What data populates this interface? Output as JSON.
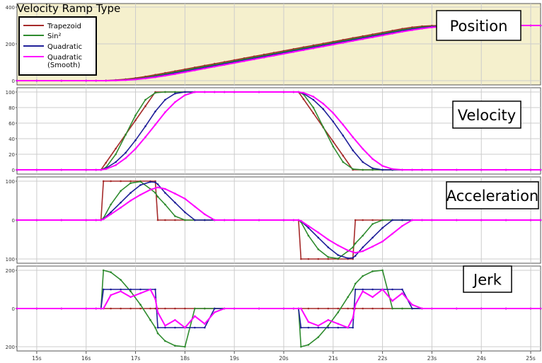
{
  "legend": {
    "title": "Velocity Ramp Type",
    "placement": "top-left",
    "items": [
      {
        "label": "Trapezoid",
        "color": "#a52a2a"
      },
      {
        "label": "Sin²",
        "color": "#2e8b2e"
      },
      {
        "label": "Quadratic",
        "color": "#1f1f99"
      },
      {
        "label": "Quadratic\n(Smooth)",
        "color": "#ff00ff"
      }
    ]
  },
  "colors": {
    "position_background": "#f5f0cd",
    "grid": "#cccccc",
    "axis": "#555555"
  },
  "x_axis": {
    "ticks": [
      15,
      16,
      17,
      18,
      19,
      20,
      21,
      22,
      23,
      24,
      25
    ],
    "tick_labels": [
      "15s",
      "16s",
      "17s",
      "18s",
      "19s",
      "20s",
      "21s",
      "22s",
      "23s",
      "24s",
      "25s"
    ],
    "range": [
      14.6,
      25.2
    ]
  },
  "chart_data": [
    {
      "type": "line",
      "title": "Position",
      "ylim": [
        0,
        400
      ],
      "yticks": [
        0,
        200,
        400
      ],
      "ytick_labels": [
        "0",
        "200",
        "400"
      ],
      "grid": true,
      "x": [
        14.6,
        15,
        15.5,
        16,
        16.2,
        16.4,
        16.6,
        16.8,
        17,
        17.2,
        17.4,
        17.6,
        17.8,
        18,
        18.2,
        18.4,
        18.6,
        18.8,
        19,
        19.2,
        19.4,
        19.6,
        19.8,
        20,
        20.2,
        20.4,
        20.6,
        20.8,
        21,
        21.2,
        21.4,
        21.6,
        21.8,
        22,
        22.2,
        22.4,
        22.6,
        22.8,
        23,
        23.5,
        24,
        24.5,
        25,
        25.2
      ],
      "series": [
        {
          "name": "Trapezoid",
          "values": [
            0,
            0,
            0,
            0,
            0,
            0.9,
            3.6,
            8.1,
            14.4,
            22.5,
            32,
            42,
            52,
            62,
            72,
            82,
            92,
            102,
            112,
            122,
            132,
            142,
            152,
            162,
            172,
            182,
            192,
            202,
            212,
            222,
            232,
            242,
            252,
            262,
            272,
            282,
            290,
            296,
            299,
            300,
            300,
            300,
            300,
            300
          ]
        },
        {
          "name": "Sin²",
          "values": [
            0,
            0,
            0,
            0,
            0,
            0.3,
            2,
            5,
            10,
            17,
            26,
            36,
            46,
            56,
            66,
            76,
            86,
            96,
            106,
            116,
            126,
            136,
            146,
            156,
            166,
            176,
            186,
            196,
            206,
            216,
            226,
            236,
            246,
            256,
            266,
            276,
            284,
            291,
            295,
            300,
            300,
            300,
            300,
            300
          ]
        },
        {
          "name": "Quadratic",
          "values": [
            0,
            0,
            0,
            0,
            0,
            0.2,
            1.5,
            4,
            8,
            14,
            22,
            31,
            41,
            51,
            61,
            71,
            81,
            91,
            101,
            111,
            121,
            131,
            141,
            151,
            161,
            171,
            181,
            191,
            201,
            211,
            221,
            231,
            241,
            251,
            261,
            271,
            280,
            287,
            293,
            300,
            300,
            300,
            300,
            300
          ]
        },
        {
          "name": "Quadratic\n(Smooth)",
          "values": [
            0,
            0,
            0,
            0,
            0,
            0.1,
            1,
            3,
            6.5,
            12,
            19,
            27,
            36,
            46,
            56,
            66,
            76,
            86,
            96,
            106,
            116,
            126,
            136,
            146,
            156,
            166,
            176,
            186,
            196,
            206,
            216,
            226,
            236,
            246,
            256,
            266,
            275,
            283,
            290,
            299,
            300,
            300,
            300,
            300
          ]
        }
      ]
    },
    {
      "type": "line",
      "title": "Velocity",
      "ylim": [
        0,
        100
      ],
      "yticks": [
        0,
        20,
        40,
        60,
        80,
        100
      ],
      "ytick_labels": [
        "0",
        "20",
        "40",
        "60",
        "80",
        "100"
      ],
      "grid": true,
      "x": [
        14.6,
        15,
        15.5,
        16,
        16.2,
        16.3,
        16.4,
        16.6,
        16.8,
        17,
        17.2,
        17.4,
        17.6,
        17.8,
        18,
        18.2,
        18.4,
        18.6,
        18.8,
        19,
        19.5,
        20,
        20.2,
        20.3,
        20.4,
        20.6,
        20.8,
        21,
        21.2,
        21.4,
        21.6,
        21.8,
        22,
        22.2,
        22.4,
        22.6,
        22.8,
        23,
        23.5,
        24,
        24.5,
        25,
        25.2
      ],
      "series": [
        {
          "name": "Trapezoid",
          "values": [
            0,
            0,
            0,
            0,
            0,
            0,
            9.1,
            27.3,
            45.5,
            63.6,
            81.8,
            100,
            100,
            100,
            100,
            100,
            100,
            100,
            100,
            100,
            100,
            100,
            100,
            100,
            90.9,
            72.7,
            54.5,
            36.4,
            18.2,
            0,
            0,
            0,
            0,
            0,
            0,
            0,
            0,
            0,
            0,
            0,
            0,
            0,
            0
          ]
        },
        {
          "name": "Sin²",
          "values": [
            0,
            0,
            0,
            0,
            0,
            0,
            3,
            20,
            45,
            70,
            90,
            99,
            100,
            100,
            100,
            100,
            100,
            100,
            100,
            100,
            100,
            100,
            100,
            100,
            97,
            80,
            55,
            30,
            10,
            1,
            0,
            0,
            0,
            0,
            0,
            0,
            0,
            0,
            0,
            0,
            0,
            0,
            0
          ]
        },
        {
          "name": "Quadratic",
          "values": [
            0,
            0,
            0,
            0,
            0,
            0,
            2,
            10,
            22,
            38,
            56,
            75,
            90,
            98,
            100,
            100,
            100,
            100,
            100,
            100,
            100,
            100,
            100,
            100,
            98,
            90,
            78,
            62,
            44,
            25,
            10,
            2,
            0,
            0,
            0,
            0,
            0,
            0,
            0,
            0,
            0,
            0,
            0
          ]
        },
        {
          "name": "Quadratic\n(Smooth)",
          "values": [
            0,
            0,
            0,
            0,
            0,
            0,
            1,
            6,
            15,
            27,
            42,
            58,
            74,
            87,
            96,
            100,
            100,
            100,
            100,
            100,
            100,
            100,
            100,
            100,
            99,
            94,
            85,
            73,
            58,
            42,
            27,
            14,
            5,
            1,
            0,
            0,
            0,
            0,
            0,
            0,
            0,
            0,
            0
          ]
        }
      ]
    },
    {
      "type": "line",
      "title": "Acceleration",
      "ylim": [
        -100,
        100
      ],
      "yticks": [
        -100,
        0,
        100
      ],
      "ytick_labels": [
        "100",
        "0",
        "100"
      ],
      "grid": true,
      "x": [
        14.6,
        15,
        15.5,
        16,
        16.2,
        16.3,
        16.35,
        16.5,
        16.7,
        16.9,
        17.1,
        17.3,
        17.4,
        17.45,
        17.6,
        17.8,
        18,
        18.2,
        18.4,
        18.6,
        18.8,
        19,
        19.5,
        20,
        20.2,
        20.3,
        20.35,
        20.5,
        20.7,
        20.9,
        21.1,
        21.3,
        21.4,
        21.45,
        21.6,
        21.8,
        22,
        22.2,
        22.4,
        22.6,
        22.8,
        23,
        23.5,
        24,
        24.5,
        25,
        25.2
      ],
      "series": [
        {
          "name": "Trapezoid",
          "values": [
            0,
            0,
            0,
            0,
            0,
            0,
            100,
            100,
            100,
            100,
            100,
            100,
            100,
            0,
            0,
            0,
            0,
            0,
            0,
            0,
            0,
            0,
            0,
            0,
            0,
            0,
            -100,
            -100,
            -100,
            -100,
            -100,
            -100,
            -100,
            0,
            0,
            0,
            0,
            0,
            0,
            0,
            0,
            0,
            0,
            0,
            0,
            0,
            0
          ]
        },
        {
          "name": "Sin²",
          "values": [
            0,
            0,
            0,
            0,
            0,
            0,
            5,
            40,
            75,
            95,
            99,
            80,
            70,
            60,
            40,
            10,
            0,
            0,
            0,
            0,
            0,
            0,
            0,
            0,
            0,
            0,
            -5,
            -40,
            -75,
            -95,
            -99,
            -80,
            -70,
            -60,
            -40,
            -10,
            0,
            0,
            0,
            0,
            0,
            0,
            0,
            0,
            0,
            0,
            0
          ]
        },
        {
          "name": "Quadratic",
          "values": [
            0,
            0,
            0,
            0,
            0,
            0,
            3,
            20,
            45,
            70,
            90,
            98,
            97,
            92,
            70,
            45,
            20,
            0,
            0,
            0,
            0,
            0,
            0,
            0,
            0,
            0,
            -3,
            -20,
            -45,
            -70,
            -90,
            -98,
            -97,
            -92,
            -70,
            -45,
            -20,
            0,
            0,
            0,
            0,
            0,
            0,
            0,
            0,
            0,
            0
          ]
        },
        {
          "name": "Quadratic\n(Smooth)",
          "values": [
            0,
            0,
            0,
            0,
            0,
            0,
            2,
            15,
            32,
            50,
            65,
            78,
            82,
            84,
            80,
            68,
            55,
            35,
            15,
            0,
            0,
            0,
            0,
            0,
            0,
            0,
            -2,
            -15,
            -32,
            -50,
            -65,
            -78,
            -82,
            -84,
            -80,
            -68,
            -55,
            -35,
            -15,
            0,
            0,
            0,
            0,
            0,
            0,
            0,
            0
          ]
        }
      ]
    },
    {
      "type": "line",
      "title": "Jerk",
      "ylim": [
        -200,
        200
      ],
      "yticks": [
        -200,
        0,
        200
      ],
      "ytick_labels": [
        "200",
        "0",
        "200"
      ],
      "grid": true,
      "x": [
        14.6,
        15,
        15.5,
        16,
        16.2,
        16.3,
        16.35,
        16.5,
        16.7,
        16.9,
        17.1,
        17.3,
        17.4,
        17.45,
        17.6,
        17.8,
        18,
        18.2,
        18.4,
        18.6,
        18.8,
        19,
        19.5,
        20,
        20.2,
        20.3,
        20.35,
        20.5,
        20.7,
        20.9,
        21.1,
        21.3,
        21.4,
        21.45,
        21.6,
        21.8,
        22,
        22.2,
        22.4,
        22.6,
        22.8,
        23,
        23.5,
        24,
        24.5,
        25,
        25.2
      ],
      "series": [
        {
          "name": "Trapezoid",
          "values": [
            0,
            0,
            0,
            0,
            0,
            0,
            0,
            0,
            0,
            0,
            0,
            0,
            0,
            0,
            0,
            0,
            0,
            0,
            0,
            0,
            0,
            0,
            0,
            0,
            0,
            0,
            0,
            0,
            0,
            0,
            0,
            0,
            0,
            0,
            0,
            0,
            0,
            0,
            0,
            0,
            0,
            0,
            0,
            0,
            0,
            0,
            0
          ]
        },
        {
          "name": "Sin²",
          "values": [
            0,
            0,
            0,
            0,
            0,
            0,
            200,
            190,
            150,
            90,
            20,
            -60,
            -100,
            -130,
            -170,
            -195,
            -200,
            0,
            0,
            0,
            0,
            0,
            0,
            0,
            0,
            0,
            -200,
            -190,
            -150,
            -90,
            -20,
            60,
            100,
            130,
            170,
            195,
            200,
            0,
            0,
            0,
            0,
            0,
            0,
            0,
            0,
            0,
            0
          ]
        },
        {
          "name": "Quadratic",
          "values": [
            0,
            0,
            0,
            0,
            0,
            0,
            100,
            100,
            100,
            100,
            100,
            100,
            100,
            -100,
            -100,
            -100,
            -100,
            -100,
            -100,
            0,
            0,
            0,
            0,
            0,
            0,
            0,
            -100,
            -100,
            -100,
            -100,
            -100,
            -100,
            -100,
            100,
            100,
            100,
            100,
            100,
            100,
            0,
            0,
            0,
            0,
            0,
            0,
            0,
            0
          ]
        },
        {
          "name": "Quadratic\n(Smooth)",
          "values": [
            0,
            0,
            0,
            0,
            0,
            0,
            0,
            70,
            90,
            60,
            80,
            100,
            50,
            -20,
            -90,
            -60,
            -100,
            -40,
            -80,
            -20,
            0,
            0,
            0,
            0,
            0,
            0,
            0,
            -70,
            -90,
            -60,
            -80,
            -100,
            -50,
            20,
            90,
            60,
            100,
            40,
            80,
            20,
            0,
            0,
            0,
            0,
            0,
            0,
            0
          ]
        }
      ]
    }
  ]
}
